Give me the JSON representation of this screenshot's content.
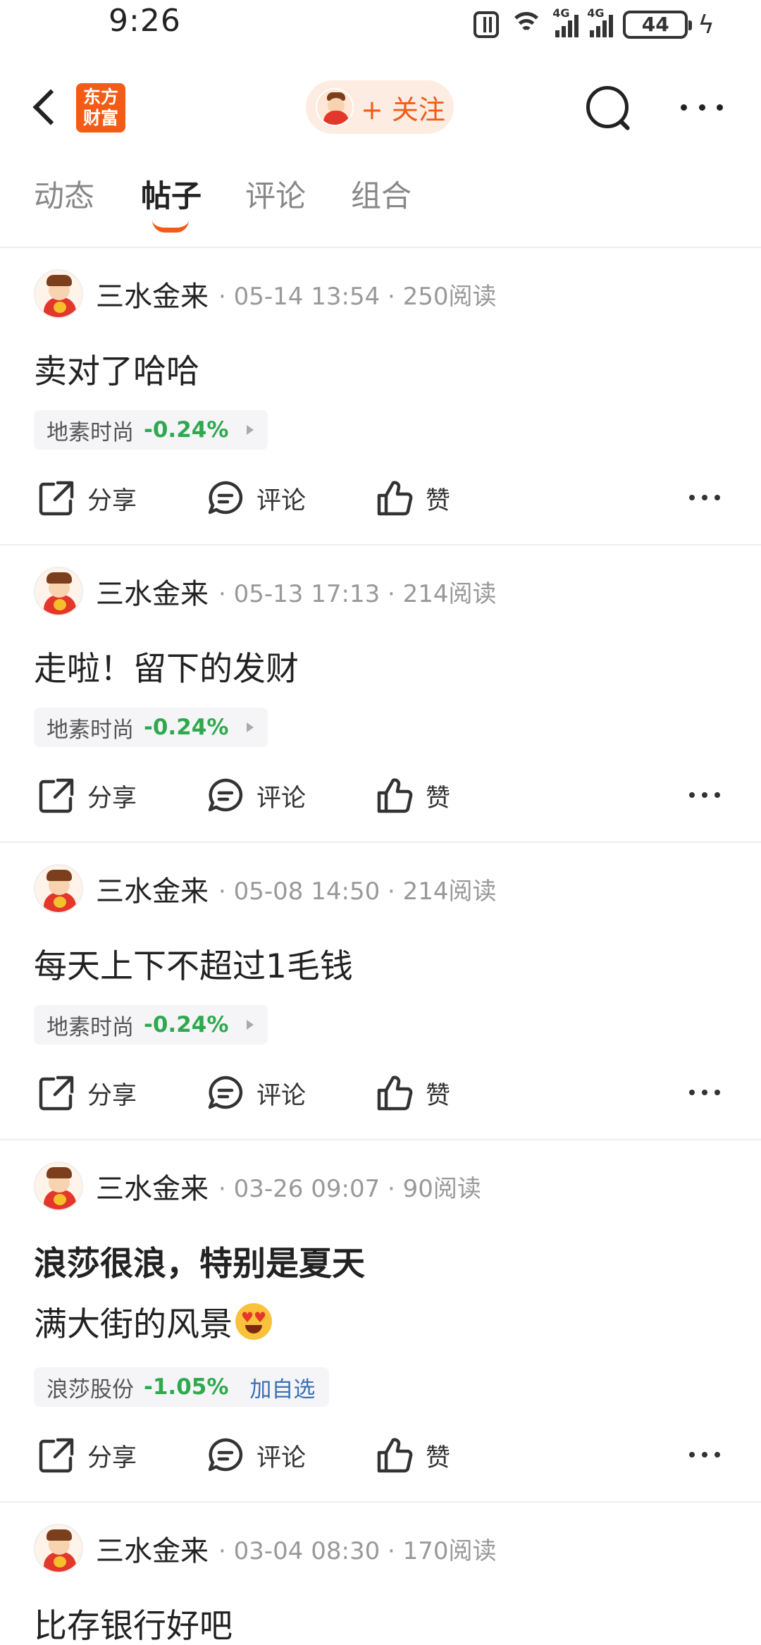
{
  "status_bar": {
    "time": "9:26",
    "battery": "44",
    "signal_label_1": "4G",
    "signal_label_2": "4G"
  },
  "nav": {
    "logo_text_line1": "东方",
    "logo_text_line2": "财富",
    "follow_label": "+ 关注"
  },
  "tabs": [
    {
      "label": "动态",
      "active": false
    },
    {
      "label": "帖子",
      "active": true
    },
    {
      "label": "评论",
      "active": false
    },
    {
      "label": "组合",
      "active": false
    }
  ],
  "action_labels": {
    "share": "分享",
    "comment": "评论",
    "like": "赞"
  },
  "posts": [
    {
      "author": "三水金来",
      "meta": "· 05-14 13:54 · 250阅读",
      "title": "卖对了哈哈",
      "title_bold": false,
      "stock": {
        "name": "地素时尚",
        "change": "-0.24%"
      }
    },
    {
      "author": "三水金来",
      "meta": "· 05-13 17:13 · 214阅读",
      "title": "走啦！留下的发财",
      "title_bold": false,
      "stock": {
        "name": "地素时尚",
        "change": "-0.24%"
      }
    },
    {
      "author": "三水金来",
      "meta": "· 05-08 14:50 · 214阅读",
      "title": "每天上下不超过1毛钱",
      "title_bold": false,
      "stock": {
        "name": "地素时尚",
        "change": "-0.24%"
      }
    },
    {
      "author": "三水金来",
      "meta": "· 03-26 09:07 · 90阅读",
      "title": "浪莎很浪，特别是夏天",
      "title_bold": true,
      "body": "满大街的风景",
      "body_emoji": "heart-eyes-emoji",
      "stock": {
        "name": "浪莎股份",
        "change": "-1.05%",
        "add_label": "加自选"
      }
    },
    {
      "author": "三水金来",
      "meta": "· 03-04 08:30 · 170阅读",
      "title": "比存银行好吧",
      "title_bold": false
    }
  ],
  "colors": {
    "brand": "#f35b16",
    "down": "#2fa84f",
    "link": "#3a6fb5"
  }
}
